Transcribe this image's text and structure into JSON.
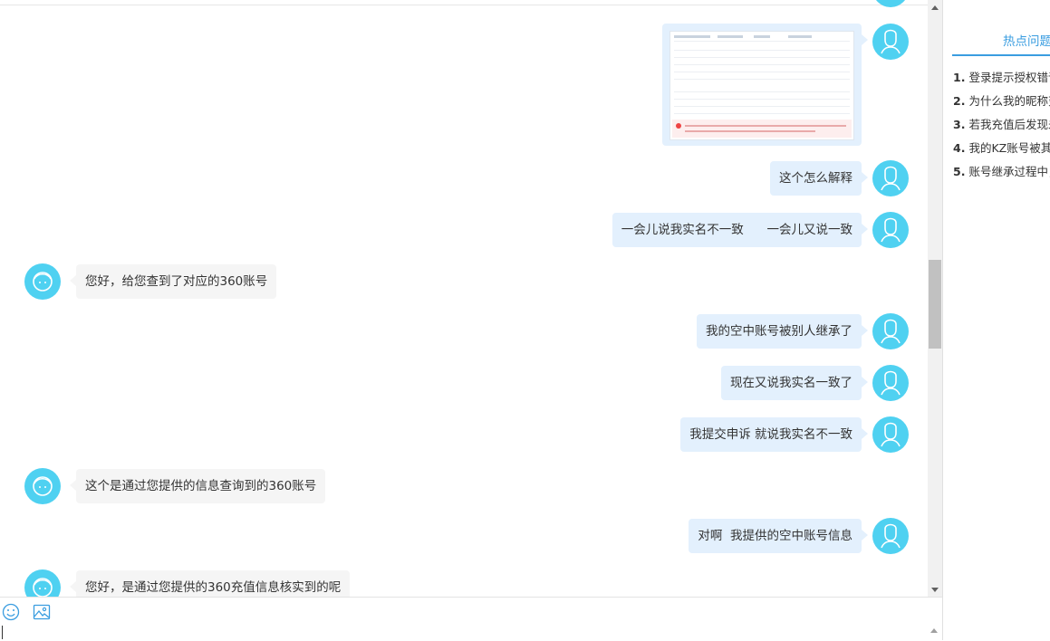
{
  "messages": {
    "u1": "这个怎么解释",
    "u2": "一会儿说我实名不一致      一会儿又说一致",
    "a1": "您好，给您查到了对应的360账号",
    "u3": "我的空中账号被别人继承了",
    "u4": "现在又说我实名一致了",
    "u5": "我提交申诉 就说我实名不一致",
    "a2": "这个是通过您提供的信息查询到的360账号",
    "u6": "对啊  我提供的空中账号信息",
    "a3": "您好，是通过您提供的360充值信息核实到的呢"
  },
  "sidebar": {
    "tab_label": "热点问题",
    "faq": [
      {
        "num": "1.",
        "text": "登录提示授权错误"
      },
      {
        "num": "2.",
        "text": "为什么我的昵称变"
      },
      {
        "num": "3.",
        "text": "若我充值后发现未"
      },
      {
        "num": "4.",
        "text": "我的KZ账号被其他"
      },
      {
        "num": "5.",
        "text": "账号继承过程中，"
      }
    ]
  },
  "toolbar": {
    "icons": [
      "emoji-icon",
      "image-upload-icon"
    ]
  },
  "colors": {
    "avatar": "#4fd1f1",
    "user_bubble": "#e3f0fd",
    "agent_bubble": "#f5f5f5",
    "accent": "#3a9de0"
  }
}
